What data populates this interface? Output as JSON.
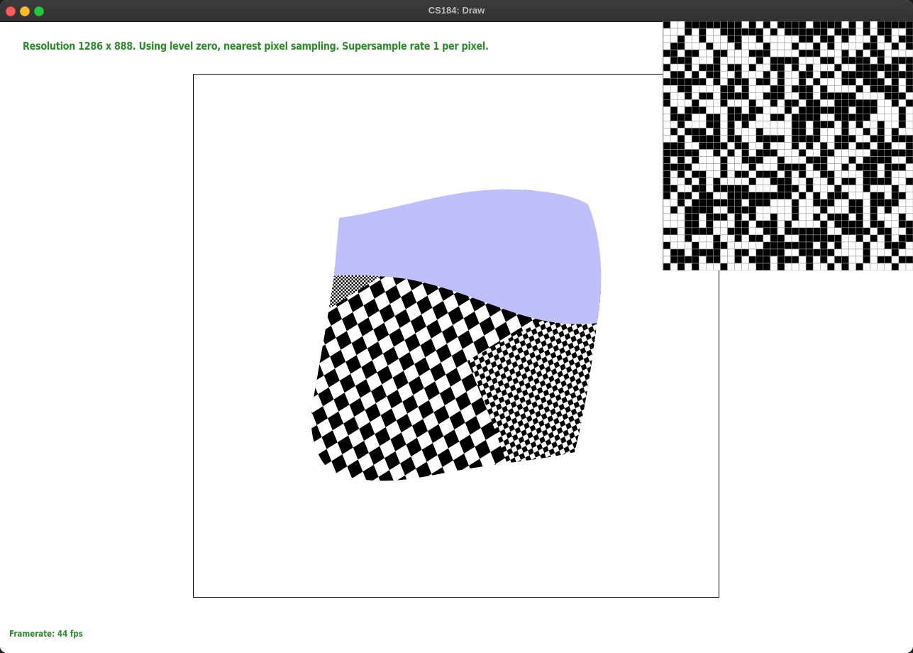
{
  "window": {
    "title": "CS184: Draw",
    "traffic_lights": [
      "close",
      "minimize",
      "maximize"
    ]
  },
  "status": {
    "resolution_text": "Resolution 1286 x 888. Using level zero, nearest pixel sampling. Supersample rate 1 per pixel.",
    "framerate_text": "Framerate: 44 fps"
  },
  "colors": {
    "status_text": "#2e8b2e",
    "sky_fill": "#bfbffc",
    "checker_dark": "#000000",
    "checker_light": "#ffffff",
    "zoom_grid_line": "#9a9a9a"
  },
  "zoom_view": {
    "grid_columns": 35,
    "grid_rows": 35
  }
}
